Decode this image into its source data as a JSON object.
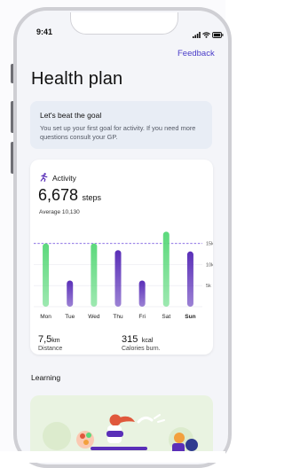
{
  "status_bar": {
    "time": "9:41"
  },
  "header": {
    "feedback_label": "Feedback",
    "title": "Health plan"
  },
  "goal_card": {
    "title": "Let's beat the goal",
    "text": "You set up your first goal for activity. If you need more questions consult your GP."
  },
  "activity": {
    "label": "Activity",
    "steps_value": "6,678",
    "steps_unit": "steps",
    "average": "Average 10,130",
    "distance_value": "7,5",
    "distance_unit": "km",
    "distance_label": "Distance",
    "calories_value": "315",
    "calories_unit": "kcal",
    "calories_label": "Calories burn."
  },
  "learning": {
    "title": "Learning"
  },
  "colors": {
    "accent": "#4a3dc9",
    "green_bar": "#5cd97c",
    "purple_bar": "#5a2fb8",
    "card_bg": "#e8edf5"
  },
  "chart_data": {
    "type": "bar",
    "categories": [
      "Mon",
      "Tue",
      "Wed",
      "Thu",
      "Fri",
      "Sat",
      "Sun"
    ],
    "values": [
      15000,
      6200,
      15000,
      13400,
      6200,
      17800,
      13100
    ],
    "bar_colors": [
      "#5cd97c",
      "#5a2fb8",
      "#5cd97c",
      "#5a2fb8",
      "#5a2fb8",
      "#5cd97c",
      "#5a2fb8"
    ],
    "highlight_category": "Sun",
    "yticks": [
      15000,
      10000,
      5000
    ],
    "ytick_labels": [
      "15k",
      "10k",
      "5k"
    ],
    "goal_line": 15000,
    "ylim": [
      0,
      18500
    ],
    "grid": true
  }
}
